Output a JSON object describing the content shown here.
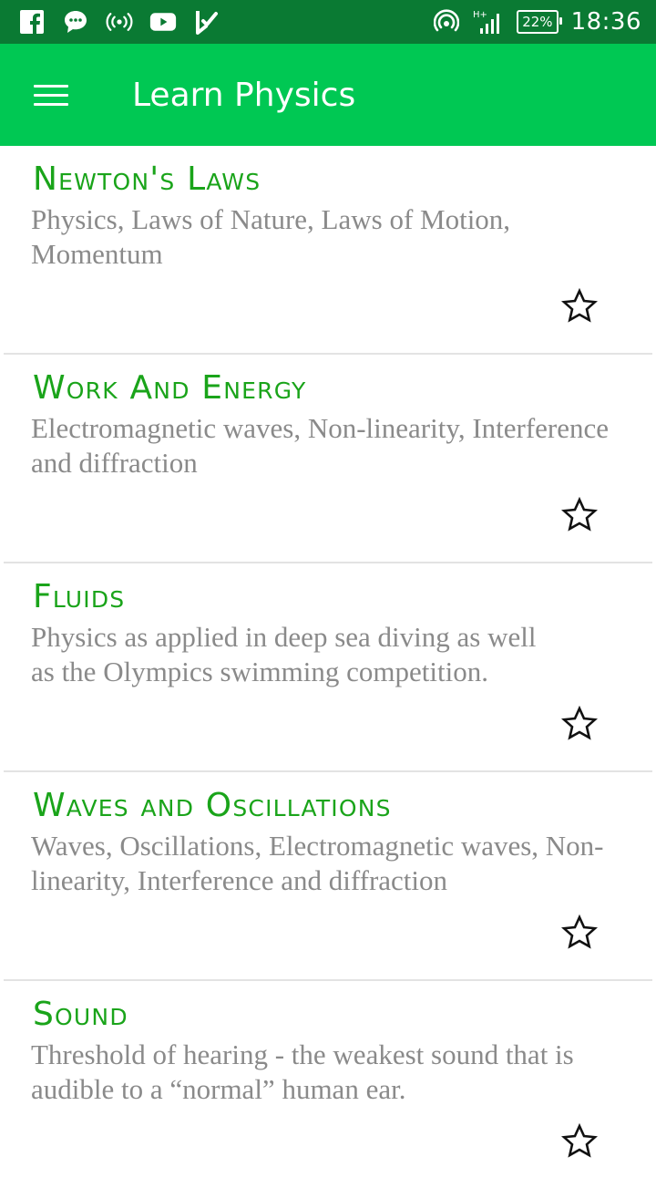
{
  "status_bar": {
    "battery": "22%",
    "time": "18:36",
    "network": "H+",
    "left_icons": [
      "facebook-icon",
      "chat-icon",
      "broadcast-icon",
      "youtube-icon",
      "check-icon"
    ],
    "right_icons": [
      "hotspot-icon",
      "signal-icon",
      "battery-icon"
    ]
  },
  "app_bar": {
    "title": "Learn Physics",
    "menu_icon": "hamburger-icon",
    "background": "#00c853"
  },
  "colors": {
    "status_bar": "#0a7a33",
    "accent": "#00c853",
    "title_text": "#1aa41a",
    "desc_text": "#8a8a8a"
  },
  "topics": [
    {
      "title": "Newton's Laws",
      "description": "Physics, Laws of Nature, Laws of Motion, Momentum",
      "favorite_icon": "star-outline-icon"
    },
    {
      "title": "Work And Energy",
      "description": "Electromagnetic waves, Non-linearity, Interference and diffraction",
      "favorite_icon": "star-outline-icon"
    },
    {
      "title": "Fluids",
      "description": "Physics as applied in deep sea diving as well as the Olympics swimming competition.",
      "favorite_icon": "star-outline-icon"
    },
    {
      "title": "Waves and Oscillations",
      "description": "Waves, Oscillations, Electromagnetic waves, Non-linearity, Interference and diffraction",
      "favorite_icon": "star-outline-icon"
    },
    {
      "title": "Sound",
      "description": "Threshold of hearing - the weakest sound that is audible to a “normal” human ear.",
      "favorite_icon": "star-outline-icon"
    }
  ]
}
